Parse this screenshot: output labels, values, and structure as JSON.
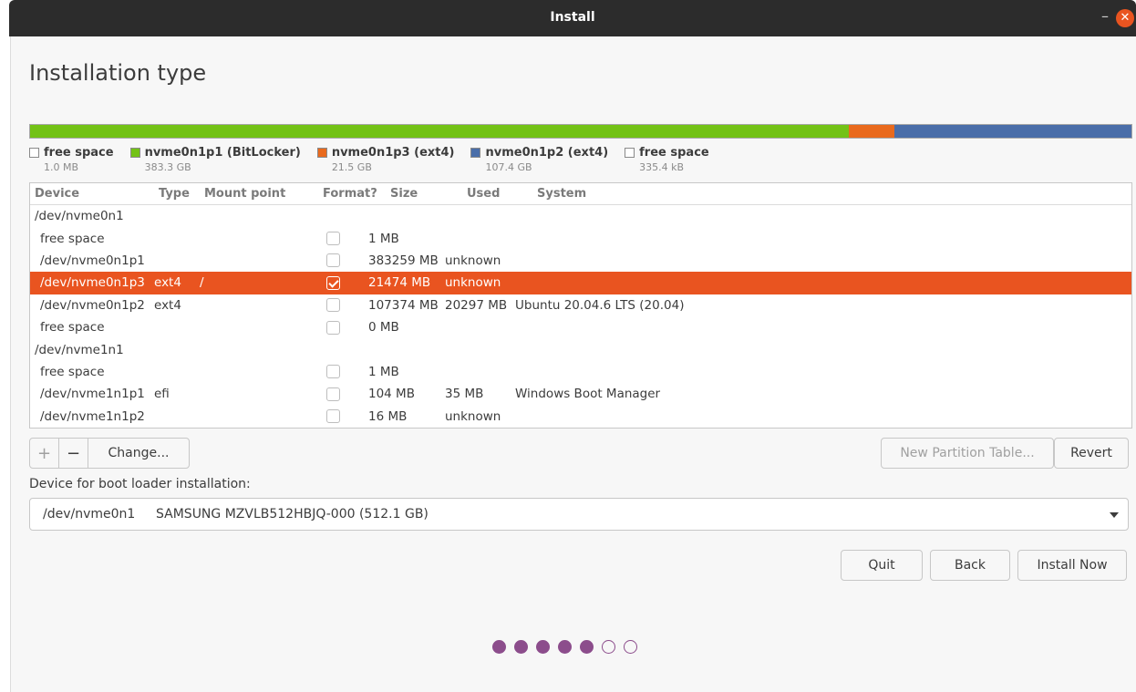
{
  "window": {
    "title": "Install"
  },
  "page": {
    "heading": "Installation type"
  },
  "colors": {
    "accent": "#e95420",
    "bitlocker": "#73c216",
    "ext4_p3": "#e96a1d",
    "ext4_p2": "#4a6ea9",
    "progress": "#8c4d8c"
  },
  "legend": [
    {
      "name": "free space",
      "size": "1.0 MB",
      "color": "#ffffff"
    },
    {
      "name": "nvme0n1p1 (BitLocker)",
      "size": "383.3 GB",
      "color": "#73c216"
    },
    {
      "name": "nvme0n1p3 (ext4)",
      "size": "21.5 GB",
      "color": "#e96a1d"
    },
    {
      "name": "nvme0n1p2 (ext4)",
      "size": "107.4 GB",
      "color": "#4a6ea9"
    },
    {
      "name": "free space",
      "size": "335.4 kB",
      "color": "#ffffff"
    }
  ],
  "table": {
    "headers": {
      "device": "Device",
      "type": "Type",
      "mount": "Mount point",
      "format": "Format?",
      "size": "Size",
      "used": "Used",
      "system": "System"
    },
    "rows": [
      {
        "device": "/dev/nvme0n1",
        "type": "",
        "mount": "",
        "size": "",
        "used": "",
        "system": ""
      },
      {
        "device": "free space",
        "type": "",
        "mount": "",
        "size": "1 MB",
        "used": "",
        "system": ""
      },
      {
        "device": "/dev/nvme0n1p1",
        "type": "",
        "mount": "",
        "size": "383259 MB",
        "used": "unknown",
        "system": ""
      },
      {
        "device": "/dev/nvme0n1p3",
        "type": "ext4",
        "mount": "/",
        "size": "21474 MB",
        "used": "unknown",
        "system": ""
      },
      {
        "device": "/dev/nvme0n1p2",
        "type": "ext4",
        "mount": "",
        "size": "107374 MB",
        "used": "20297 MB",
        "system": "Ubuntu 20.04.6 LTS (20.04)"
      },
      {
        "device": "free space",
        "type": "",
        "mount": "",
        "size": "0 MB",
        "used": "",
        "system": ""
      },
      {
        "device": "/dev/nvme1n1",
        "type": "",
        "mount": "",
        "size": "",
        "used": "",
        "system": ""
      },
      {
        "device": "free space",
        "type": "",
        "mount": "",
        "size": "1 MB",
        "used": "",
        "system": ""
      },
      {
        "device": "/dev/nvme1n1p1",
        "type": "efi",
        "mount": "",
        "size": "104 MB",
        "used": "35 MB",
        "system": "Windows Boot Manager"
      },
      {
        "device": "/dev/nvme1n1p2",
        "type": "",
        "mount": "",
        "size": "16 MB",
        "used": "unknown",
        "system": ""
      }
    ]
  },
  "toolbar": {
    "add": "+",
    "remove": "−",
    "change": "Change...",
    "new_table": "New Partition Table...",
    "revert": "Revert"
  },
  "boot": {
    "label": "Device for boot loader installation:",
    "device": "/dev/nvme0n1",
    "description": "SAMSUNG MZVLB512HBJQ-000 (512.1 GB)"
  },
  "buttons": {
    "quit": "Quit",
    "back": "Back",
    "install": "Install Now"
  },
  "progress": {
    "current": 5,
    "total": 7
  }
}
